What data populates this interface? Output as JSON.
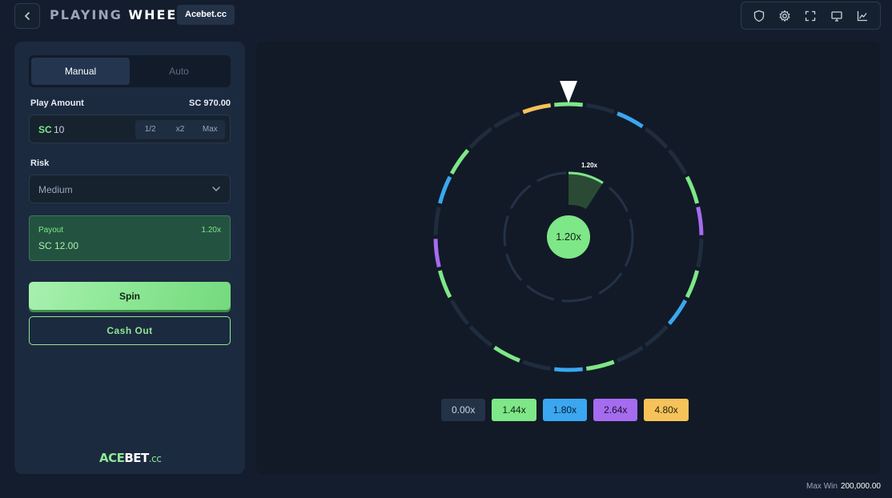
{
  "header": {
    "title_part1": "PLAYING",
    "title_part2": "WHEEL",
    "badge": "Acebet.cc",
    "tools": [
      "shield-icon",
      "gear-icon",
      "fullscreen-icon",
      "monitor-icon",
      "chart-icon"
    ]
  },
  "controls": {
    "tabs": [
      "Manual",
      "Auto"
    ],
    "active_tab": "Manual",
    "play_amount_label": "Play Amount",
    "balance": "SC 970.00",
    "amount_currency": "SC",
    "amount_value": "10",
    "amount_buttons": [
      "1/2",
      "x2",
      "Max"
    ],
    "risk_label": "Risk",
    "risk_value": "Medium",
    "payout_label": "Payout",
    "payout_multiplier": "1.20x",
    "payout_value": "SC 12.00",
    "spin_label": "Spin",
    "cashout_label": "Cash Out"
  },
  "logo": {
    "part1": "ACE",
    "part2": "BET",
    "part3": ".cc"
  },
  "wheel": {
    "center_value": "1.20x",
    "indicator_label": "1.20x",
    "segments": [
      "green",
      "none",
      "blue",
      "none",
      "none",
      "green",
      "purple",
      "none",
      "green",
      "blue",
      "none",
      "none",
      "green",
      "blue",
      "none",
      "green",
      "none",
      "none",
      "green",
      "purple",
      "none",
      "blue",
      "green",
      "none",
      "none",
      "yellow"
    ]
  },
  "multipliers": [
    {
      "label": "0.00x",
      "bg": "#243247",
      "fg": "#c9d2de"
    },
    {
      "label": "1.44x",
      "bg": "#7ee787",
      "fg": "#0f2214"
    },
    {
      "label": "1.80x",
      "bg": "#3aa7f0",
      "fg": "#0b1a2a"
    },
    {
      "label": "2.64x",
      "bg": "#a56cf0",
      "fg": "#1a0f2a"
    },
    {
      "label": "4.80x",
      "bg": "#f5c35a",
      "fg": "#2a1f0a"
    }
  ],
  "colors": {
    "green": "#7ee787",
    "blue": "#3aa7f0",
    "purple": "#a56cf0",
    "yellow": "#f5c35a",
    "none": "#1f2c3e"
  },
  "footer": {
    "max_win_label": "Max Win",
    "max_win_value": "200,000.00"
  }
}
